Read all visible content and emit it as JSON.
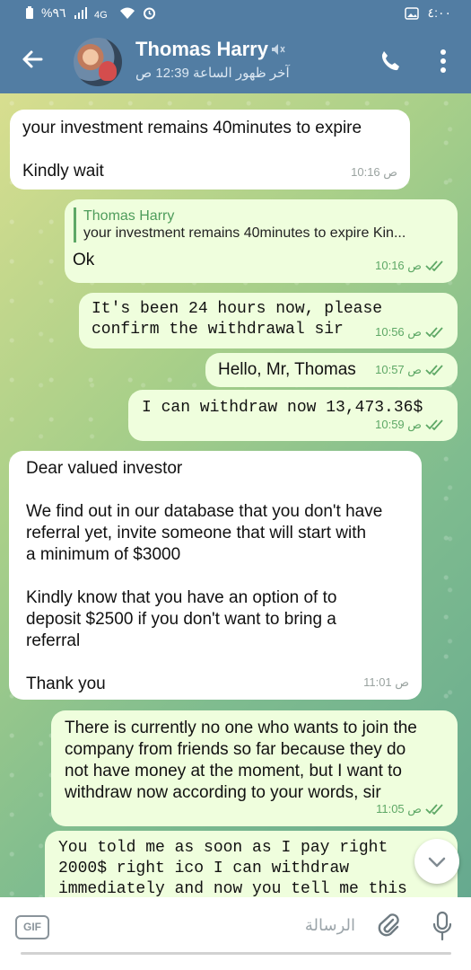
{
  "status_bar": {
    "left_text": "%٩٦",
    "right_time": "٤:٠٠",
    "icons": [
      "battery-icon",
      "signal-icon",
      "lte-icon",
      "wifi-icon",
      "alarm-icon",
      "gallery-icon"
    ]
  },
  "header": {
    "title": "Thomas Harry",
    "subtitle": "آخر ظهور الساعة 12:39 ص",
    "icons": [
      "back-arrow-icon",
      "mute-icon",
      "phone-icon",
      "more-vertical-icon"
    ]
  },
  "messages": [
    {
      "direction": "in",
      "text": "your investment remains 40minutes to expire\n\nKindly wait",
      "time": "10:16 ص"
    },
    {
      "direction": "out",
      "reply_author": "Thomas Harry",
      "reply_text": "your investment remains 40minutes to expire  Kin...",
      "text": "Ok",
      "time": "10:16 ص"
    },
    {
      "direction": "out",
      "text": "It's been 24 hours now, please\nconfirm the withdrawal sir",
      "time": "10:56 ص"
    },
    {
      "direction": "out",
      "text": "Hello, Mr, Thomas",
      "time": "10:57 ص"
    },
    {
      "direction": "out",
      "text": "I can withdraw now 13,473.36$",
      "time": "10:59 ص"
    },
    {
      "direction": "in",
      "text": "Dear valued investor\n\nWe find out in our database that you don't have\nreferral yet, invite someone that will start with\na minimum of $3000\n\nKindly know that you have an option of to\ndeposit $2500 if you don't want to bring a\nreferral\n\nThank you",
      "time": "11:01 ص"
    },
    {
      "direction": "out",
      "text": "There is currently no one who wants to join the\ncompany from friends so far because they do\nnot have money at the moment, but I want to\nwithdraw now according to your words, sir",
      "time": "11:05 ص"
    },
    {
      "direction": "out",
      "text": "You told me as soon as I pay right\n2000$ right ico I can withdraw\nimmediately and now you tell me this",
      "time": ""
    }
  ],
  "composer": {
    "gif_label": "GIF",
    "placeholder": "الرسالة"
  }
}
